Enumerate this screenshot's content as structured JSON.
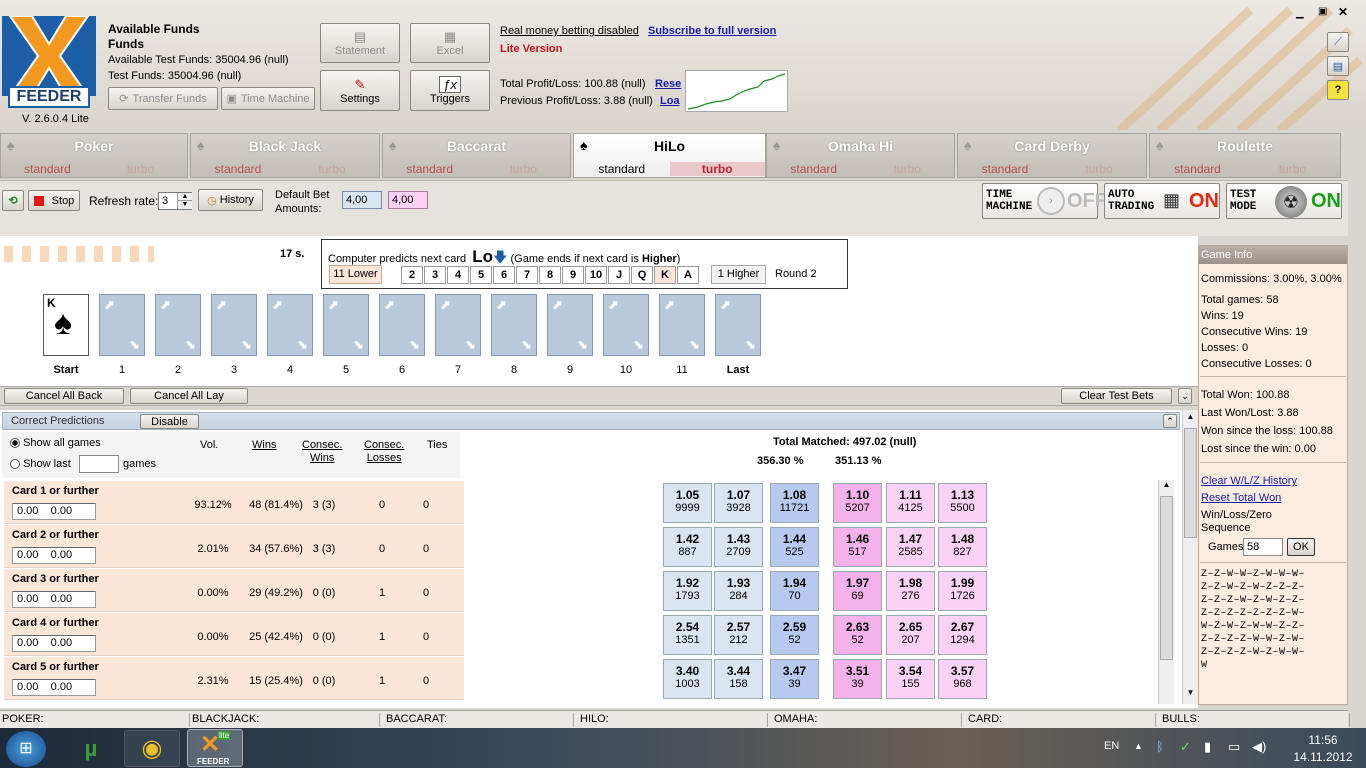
{
  "header": {
    "logo_text": "FEEDER",
    "version": "V. 2.6.0.4 Lite",
    "available_funds": "Available Funds",
    "funds": "Funds",
    "available_test_funds": "Available Test Funds: 35004.96 (null)",
    "test_funds": "Test Funds: 35004.96 (null)",
    "transfer_funds": "Transfer Funds",
    "time_machine": "Time Machine",
    "statement": "Statement",
    "excel": "Excel",
    "settings": "Settings",
    "triggers": "Triggers",
    "real_money_disabled": "Real money betting disabled",
    "subscribe": "Subscribe to full version",
    "lite_version": "Lite Version",
    "total_pl": "Total Profit/Loss: 100.88 (null)",
    "previous_pl": "Previous Profit/Loss: 3.88 (null)",
    "reset": "Rese",
    "load": "Loa"
  },
  "tabs": [
    {
      "title": "Poker",
      "standard": "standard",
      "turbo": "turbo"
    },
    {
      "title": "Black Jack",
      "standard": "standard",
      "turbo": "turbo"
    },
    {
      "title": "Baccarat",
      "standard": "standard",
      "turbo": "turbo"
    },
    {
      "title": "HiLo",
      "standard": "standard",
      "turbo": "turbo"
    },
    {
      "title": "Omaha Hi",
      "standard": "standard",
      "turbo": "turbo"
    },
    {
      "title": "Card Derby",
      "standard": "standard",
      "turbo": "turbo"
    },
    {
      "title": "Roulette",
      "standard": "standard",
      "turbo": "turbo"
    }
  ],
  "toolbar": {
    "stop": "Stop",
    "refresh_label": "Refresh rate:",
    "refresh_value": "3",
    "history": "History",
    "default_bet_label": "Default Bet",
    "amounts_label": "Amounts:",
    "bet_back": "4,00",
    "bet_lay": "4,00",
    "time_label_1": "TIME",
    "time_label_2": "MACHINE",
    "time_state": "OFF",
    "auto_label_1": "AUTO",
    "auto_label_2": "TRADING",
    "auto_state": "ON",
    "test_label_1": "TEST",
    "test_label_2": "MODE",
    "test_state": "ON"
  },
  "game": {
    "timer": "17 s.",
    "predict_prefix": "Computer predicts next card",
    "predict_value": "Lo",
    "predict_suffix": "(Game ends if next card is",
    "predict_higher": "Higher",
    "predict_close": ")",
    "lower_box": "11 Lower",
    "ranks": [
      "2",
      "3",
      "4",
      "5",
      "6",
      "7",
      "8",
      "9",
      "10",
      "J",
      "Q",
      "K",
      "A"
    ],
    "higher_box": "1 Higher",
    "round": "Round 2",
    "start_card_rank": "K",
    "card_labels": [
      "Start",
      "1",
      "2",
      "3",
      "4",
      "5",
      "6",
      "7",
      "8",
      "9",
      "10",
      "11",
      "Last"
    ],
    "cancel_back": "Cancel All Back",
    "cancel_lay": "Cancel All Lay",
    "clear_test": "Clear Test Bets"
  },
  "predictions": {
    "title": "Correct Predictions",
    "disable": "Disable",
    "show_all": "Show all games",
    "show_last": "Show last",
    "games": "games",
    "h_vol": "Vol.",
    "h_wins": "Wins",
    "h_consec_wins_1": "Consec.",
    "h_consec_wins_2": "Wins",
    "h_consec_losses_1": "Consec.",
    "h_consec_losses_2": "Losses",
    "h_ties": "Ties",
    "total_matched": "Total Matched: 497.02 (null)",
    "pct_back": "356.30 %",
    "pct_lay": "351.13 %",
    "rows": [
      {
        "title": "Card 1 or further",
        "v1": "0.00",
        "v2": "0.00",
        "vol": "93.12%",
        "wins": "48 (81.4%)",
        "cw": "3 (3)",
        "cl": "0",
        "ties": "0",
        "odds": [
          [
            "1.05",
            "9999"
          ],
          [
            "1.07",
            "3928"
          ],
          [
            "1.08",
            "11721"
          ],
          [
            "1.10",
            "5207"
          ],
          [
            "1.11",
            "4125"
          ],
          [
            "1.13",
            "5500"
          ]
        ]
      },
      {
        "title": "Card 2 or further",
        "v1": "0.00",
        "v2": "0.00",
        "vol": "2.01%",
        "wins": "34 (57.6%)",
        "cw": "3 (3)",
        "cl": "0",
        "ties": "0",
        "odds": [
          [
            "1.42",
            "887"
          ],
          [
            "1.43",
            "2709"
          ],
          [
            "1.44",
            "525"
          ],
          [
            "1.46",
            "517"
          ],
          [
            "1.47",
            "2585"
          ],
          [
            "1.48",
            "827"
          ]
        ]
      },
      {
        "title": "Card 3 or further",
        "v1": "0.00",
        "v2": "0.00",
        "vol": "0.00%",
        "wins": "29 (49.2%)",
        "cw": "0 (0)",
        "cl": "1",
        "ties": "0",
        "odds": [
          [
            "1.92",
            "1793"
          ],
          [
            "1.93",
            "284"
          ],
          [
            "1.94",
            "70"
          ],
          [
            "1.97",
            "69"
          ],
          [
            "1.98",
            "276"
          ],
          [
            "1.99",
            "1726"
          ]
        ]
      },
      {
        "title": "Card 4 or further",
        "v1": "0.00",
        "v2": "0.00",
        "vol": "0.00%",
        "wins": "25 (42.4%)",
        "cw": "0 (0)",
        "cl": "1",
        "ties": "0",
        "odds": [
          [
            "2.54",
            "1351"
          ],
          [
            "2.57",
            "212"
          ],
          [
            "2.59",
            "52"
          ],
          [
            "2.63",
            "52"
          ],
          [
            "2.65",
            "207"
          ],
          [
            "2.67",
            "1294"
          ]
        ]
      },
      {
        "title": "Card 5 or further",
        "v1": "0.00",
        "v2": "0.00",
        "vol": "2.31%",
        "wins": "15 (25.4%)",
        "cw": "0 (0)",
        "cl": "1",
        "ties": "0",
        "odds": [
          [
            "3.40",
            "1003"
          ],
          [
            "3.44",
            "158"
          ],
          [
            "3.47",
            "39"
          ],
          [
            "3.51",
            "39"
          ],
          [
            "3.54",
            "155"
          ],
          [
            "3.57",
            "968"
          ]
        ]
      }
    ]
  },
  "game_info": {
    "title": "Game Info",
    "commissions": "Commissions: 3.00%, 3.00%",
    "total_games": "Total games: 58",
    "wins": "Wins: 19",
    "consec_wins": "Consecutive Wins: 19",
    "losses": "Losses: 0",
    "consec_losses": "Consecutive Losses: 0",
    "total_won": "Total Won: 100.88",
    "last_won": "Last Won/Lost: 3.88",
    "won_since": "Won since the loss: 100.88",
    "lost_since": "Lost since the win: 0.00",
    "clear_history": "Clear W/L/Z History",
    "reset_total": "Reset Total Won",
    "sequence_1": "Win/Loss/Zero",
    "sequence_2": "Sequence",
    "games_label": "Games",
    "games_value": "58",
    "ok": "OK",
    "seq_lines": [
      "Z–Z–W–W–Z–W–W–W–",
      "Z–Z–W–Z–W–Z–Z–Z–",
      "Z–Z–Z–W–Z–W–Z–Z–",
      "Z–Z–Z–Z–Z–Z–Z–W–",
      "W–Z–W–Z–W–W–Z–Z–",
      "Z–Z–Z–Z–W–W–Z–W–",
      "Z–Z–Z–Z–W–Z–W–W–",
      "W"
    ]
  },
  "statusbar": [
    "POKER:",
    "BLACKJACK:",
    "BACCARAT:",
    "HILO:",
    "OMAHA:",
    "CARD:",
    "BULLS:"
  ],
  "taskbar": {
    "lang": "EN",
    "time": "11:56",
    "date": "14.11.2012",
    "app_label": "FEEDER",
    "app_badge": "lite"
  },
  "colors": {
    "back": "#dbe4f1",
    "back_best": "#b7c9ef",
    "lay": "#fbd2f5",
    "lay_best": "#f4b1ec",
    "accent_red": "#c4121a",
    "link_blue": "#1a1aa6"
  }
}
